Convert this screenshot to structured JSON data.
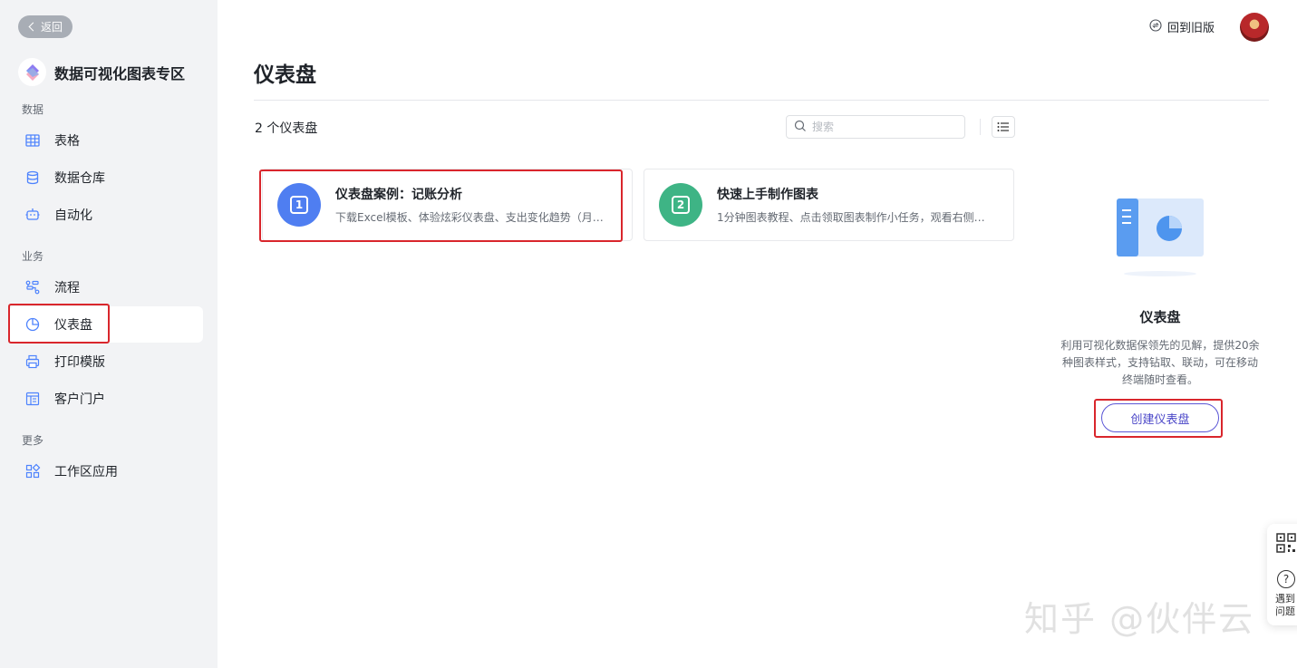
{
  "sidebar": {
    "back_label": "返回",
    "app_title": "数据可视化图表专区",
    "sections": {
      "data": "数据",
      "business": "业务",
      "more": "更多"
    },
    "items": {
      "table": "表格",
      "warehouse": "数据仓库",
      "automation": "自动化",
      "workflow": "流程",
      "dashboard": "仪表盘",
      "print_template": "打印模版",
      "customer_portal": "客户门户",
      "workspace_apps": "工作区应用"
    },
    "active_item": "dashboard"
  },
  "topbar": {
    "old_version_label": "回到旧版"
  },
  "main": {
    "title": "仪表盘",
    "count_text": "2 个仪表盘",
    "search_placeholder": "搜索",
    "cards": [
      {
        "badge": "1",
        "badge_color": "#4f7ef1",
        "title": "仪表盘案例：记账分析",
        "desc": "下载Excel模板、体验炫彩仪表盘、支出变化趋势（月）..."
      },
      {
        "badge": "2",
        "badge_color": "#3eb485",
        "title": "快速上手制作图表",
        "desc": "1分钟图表教程、点击领取图表制作小任务，观看右侧教..."
      }
    ]
  },
  "panel": {
    "title": "仪表盘",
    "desc": "利用可视化数据保领先的见解，提供20余种图表样式，支持钻取、联动，可在移动终端随时查看。",
    "create_label": "创建仪表盘"
  },
  "float_bar": {
    "help_text": "遇到问题"
  },
  "watermark": "知乎 @伙伴云",
  "colors": {
    "highlight_border": "#d9262c",
    "accent": "#5b57d6"
  }
}
